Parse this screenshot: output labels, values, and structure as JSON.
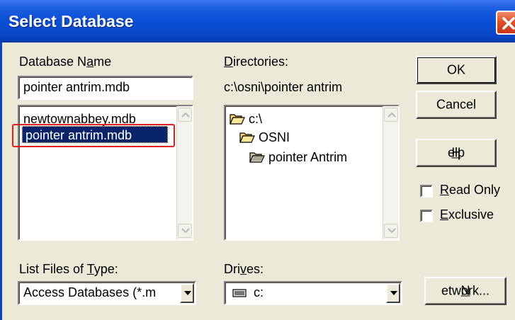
{
  "window": {
    "title": "Select Database"
  },
  "database_name": {
    "label_pre": "Database N",
    "label_accel": "a",
    "label_post": "me",
    "value": "pointer antrim.mdb",
    "files": [
      "newtownabbey.mdb",
      "pointer antrim.mdb"
    ]
  },
  "directories": {
    "label_accel": "D",
    "label_post": "irectories:",
    "current_path": "c:\\osni\\pointer antrim",
    "items": [
      "c:\\",
      "OSNI",
      "pointer Antrim"
    ]
  },
  "file_type": {
    "label_pre": "List Files of ",
    "label_accel": "T",
    "label_post": "ype:",
    "value": "Access Databases (*.m"
  },
  "drives": {
    "label_pre": "Dri",
    "label_accel": "v",
    "label_post": "es:",
    "value": "c:"
  },
  "buttons": {
    "ok": "OK",
    "cancel": "Cancel",
    "help_accel": "H",
    "help_post": "elp",
    "network_accel": "N",
    "network_post": "etwork..."
  },
  "checkboxes": {
    "read_only_accel": "R",
    "read_only_post": "ead Only",
    "read_only_checked": false,
    "exclusive_accel": "E",
    "exclusive_post": "xclusive",
    "exclusive_checked": false
  },
  "colors": {
    "titlebar": "#0a47c8",
    "selection": "#0a246a",
    "highlight_box": "#e02020",
    "dialog_bg": "#ece9d8"
  },
  "icons": [
    "close-icon",
    "open-folder-icon",
    "drive-icon",
    "chevron-down-icon",
    "chevron-up-icon"
  ]
}
